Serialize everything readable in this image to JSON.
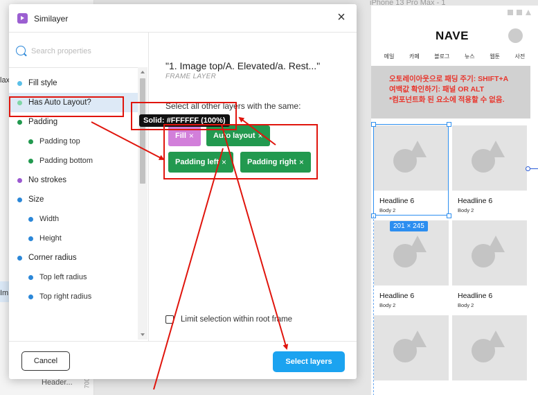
{
  "background": {
    "left_panel_peeks": [
      "lax",
      "Im",
      "Header..."
    ],
    "ruler_number": "700",
    "frame_label": "iPhone 13 Pro Max - 1",
    "phone": {
      "logo": "NAVE",
      "menu": [
        "메일",
        "카페",
        "블로그",
        "뉴스",
        "웹툰",
        "사전"
      ],
      "notice_lines": [
        "오토레이아웃으로 패딩 주기: SHIFT+A",
        "여백값 확인하기: 패널 OR ALT",
        "*컴포넌트화 된 요소에 적용할 수 없음."
      ],
      "cards": [
        {
          "headline": "Headline 6",
          "body": "Body 2"
        },
        {
          "headline": "Headline 6",
          "body": "Body 2"
        },
        {
          "headline": "Headline 6",
          "body": "Body 2"
        },
        {
          "headline": "Headline 6",
          "body": "Body 2"
        }
      ],
      "selection_size": "201 × 245"
    }
  },
  "plugin": {
    "title": "Similayer",
    "search_placeholder": "Search properties",
    "properties": [
      {
        "label": "Fill style",
        "color": "#5bc0e8",
        "sub": false
      },
      {
        "label": "Has Auto Layout?",
        "color": "#7fd6a6",
        "sub": false,
        "selected": true
      },
      {
        "label": "Padding",
        "color": "#22994f",
        "sub": false
      },
      {
        "label": "Padding top",
        "color": "#22994f",
        "sub": true
      },
      {
        "label": "Padding bottom",
        "color": "#22994f",
        "sub": true
      },
      {
        "label": "No strokes",
        "color": "#9b59d0",
        "sub": false
      },
      {
        "label": "Size",
        "color": "#2b87d8",
        "sub": false
      },
      {
        "label": "Width",
        "color": "#2b87d8",
        "sub": true
      },
      {
        "label": "Height",
        "color": "#2b87d8",
        "sub": true
      },
      {
        "label": "Corner radius",
        "color": "#2b87d8",
        "sub": false
      },
      {
        "label": "Top left radius",
        "color": "#2b87d8",
        "sub": true
      },
      {
        "label": "Top right radius",
        "color": "#2b87d8",
        "sub": true
      }
    ],
    "layer_name": "\"1. Image top/A. Elevated/a. Rest...\"",
    "layer_type": "FRAME LAYER",
    "same_label": "Select all other layers with the same:",
    "tooltip": "Solid: #FFFFFF (100%)",
    "chips": [
      {
        "label": "Fill",
        "color": "#d27fda"
      },
      {
        "label": "Auto layout",
        "color": "#22994f"
      },
      {
        "label": "Padding left",
        "color": "#22994f"
      },
      {
        "label": "Padding right",
        "color": "#22994f"
      }
    ],
    "chip_remove_glyph": "×",
    "checkbox_label": "Limit selection within root frame",
    "checkbox_checked": false,
    "cancel_label": "Cancel",
    "select_label": "Select layers",
    "close_glyph": "×"
  },
  "annotation_color": "#e0140c"
}
